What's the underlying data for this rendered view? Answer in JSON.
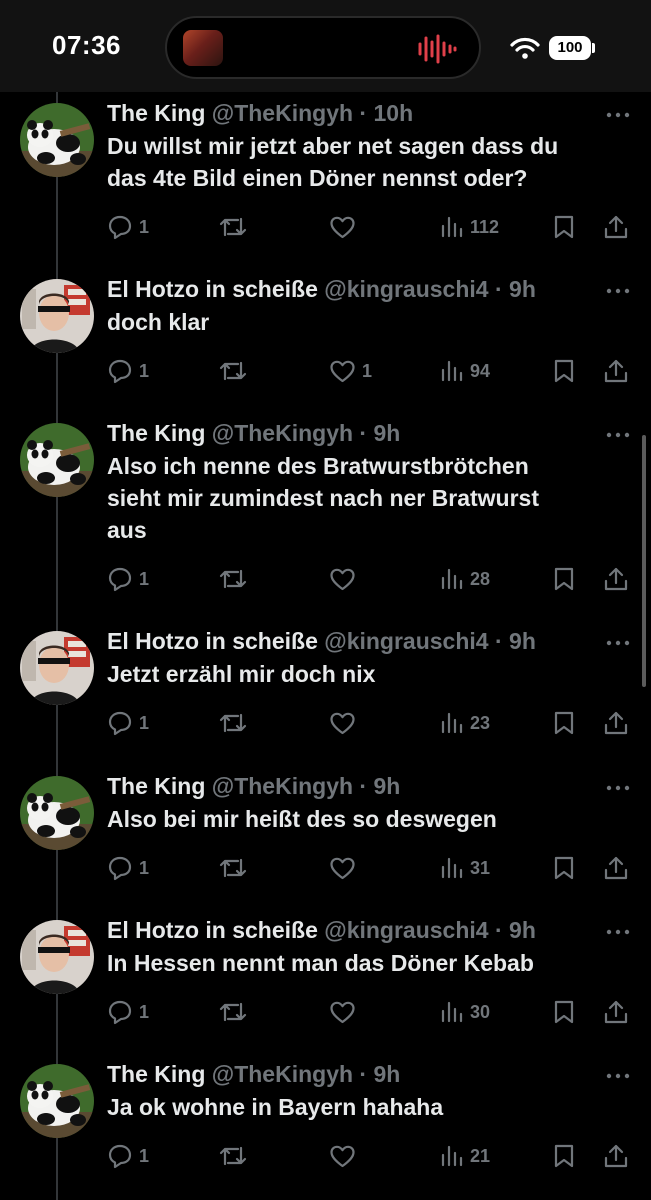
{
  "status_bar": {
    "time": "07:36",
    "battery": "100"
  },
  "tweets": [
    {
      "author": "The King",
      "handle": "@TheKingyh",
      "time": "10h",
      "avatar": "panda",
      "text": [
        "Du willst mir jetzt aber net sagen dass du",
        "das 4te Bild einen Döner nennst oder?"
      ],
      "replies": "1",
      "reposts": "",
      "likes": "",
      "views": "112"
    },
    {
      "author": "El Hotzo in scheiße",
      "handle": "@kingrauschi4",
      "time": "9h",
      "avatar": "man",
      "text": [
        "doch klar"
      ],
      "replies": "1",
      "reposts": "",
      "likes": "1",
      "views": "94"
    },
    {
      "author": "The King",
      "handle": "@TheKingyh",
      "time": "9h",
      "avatar": "panda",
      "text": [
        "Also ich nenne des Bratwurstbrötchen",
        "sieht mir zumindest nach ner Bratwurst",
        "aus"
      ],
      "replies": "1",
      "reposts": "",
      "likes": "",
      "views": "28"
    },
    {
      "author": "El Hotzo in scheiße",
      "handle": "@kingrauschi4",
      "time": "9h",
      "avatar": "man",
      "text": [
        "Jetzt erzähl mir doch nix"
      ],
      "replies": "1",
      "reposts": "",
      "likes": "",
      "views": "23"
    },
    {
      "author": "The King",
      "handle": "@TheKingyh",
      "time": "9h",
      "avatar": "panda",
      "text": [
        "Also bei mir heißt des so deswegen"
      ],
      "replies": "1",
      "reposts": "",
      "likes": "",
      "views": "31"
    },
    {
      "author": "El Hotzo in scheiße",
      "handle": "@kingrauschi4",
      "time": "9h",
      "avatar": "man",
      "text": [
        "In Hessen nennt man das Döner Kebab"
      ],
      "replies": "1",
      "reposts": "",
      "likes": "",
      "views": "30"
    },
    {
      "author": "The King",
      "handle": "@TheKingyh",
      "time": "9h",
      "avatar": "panda",
      "text": [
        "Ja ok wohne in Bayern hahaha"
      ],
      "replies": "1",
      "reposts": "",
      "likes": "",
      "views": "21"
    }
  ],
  "colors": {
    "background": "#000000",
    "text": "#e7e9ea",
    "muted": "#71767b",
    "divider": "#333639"
  }
}
